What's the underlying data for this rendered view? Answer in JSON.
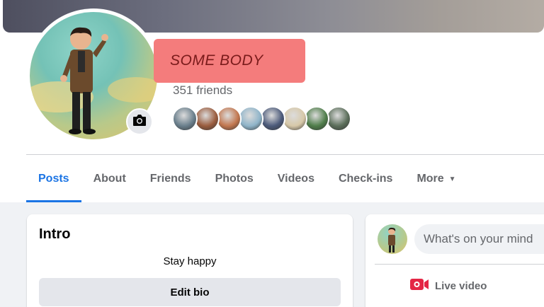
{
  "profile": {
    "name": "SOME BODY",
    "friends_count": "351 friends",
    "friend_avatar_colors": [
      "#6a7f8c",
      "#9a5c3e",
      "#c2764e",
      "#8fb4c9",
      "#4c5a7a",
      "#d7c8a8",
      "#4f7d4a",
      "#5b6e5a"
    ]
  },
  "tabs": [
    {
      "label": "Posts",
      "active": true
    },
    {
      "label": "About"
    },
    {
      "label": "Friends"
    },
    {
      "label": "Photos"
    },
    {
      "label": "Videos"
    },
    {
      "label": "Check-ins"
    },
    {
      "label": "More"
    }
  ],
  "intro": {
    "title": "Intro",
    "bio": "Stay happy",
    "edit_bio_label": "Edit bio"
  },
  "composer": {
    "placeholder": "What's on your mind",
    "live_video_label": "Live video"
  },
  "colors": {
    "accent": "#1b74e4",
    "live_red": "#e42645",
    "name_highlight": "#f47c7c"
  },
  "icons": {
    "camera": "camera-icon",
    "more_arrow": "caret-down-icon",
    "live": "live-video-icon"
  }
}
